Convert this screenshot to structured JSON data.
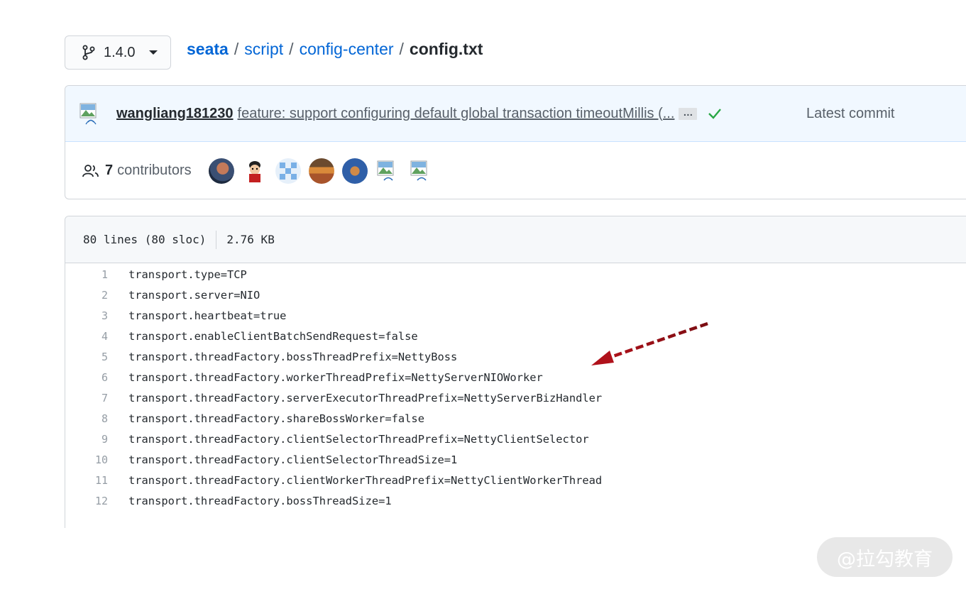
{
  "branch": {
    "label": "1.4.0"
  },
  "breadcrumb": {
    "root": "seata",
    "parts": [
      "script",
      "config-center"
    ],
    "separator": "/",
    "file": "config.txt"
  },
  "commit": {
    "author": "wangliang181230",
    "message": "feature: support configuring default global transaction timeoutMillis (...",
    "ellipsis": "…",
    "latest_label": "Latest commit",
    "status_color": "#28a745"
  },
  "contributors": {
    "count": "7",
    "label": "contributors",
    "avatars": [
      "avatar-1",
      "avatar-2",
      "avatar-3",
      "avatar-4",
      "avatar-5",
      "avatar-6-broken",
      "avatar-7-broken"
    ]
  },
  "file": {
    "lines_info": "80 lines (80 sloc)",
    "size": "2.76 KB",
    "lines": [
      {
        "n": "1",
        "text": "transport.type=TCP"
      },
      {
        "n": "2",
        "text": "transport.server=NIO"
      },
      {
        "n": "3",
        "text": "transport.heartbeat=true"
      },
      {
        "n": "4",
        "text": "transport.enableClientBatchSendRequest=false"
      },
      {
        "n": "5",
        "text": "transport.threadFactory.bossThreadPrefix=NettyBoss"
      },
      {
        "n": "6",
        "text": "transport.threadFactory.workerThreadPrefix=NettyServerNIOWorker"
      },
      {
        "n": "7",
        "text": "transport.threadFactory.serverExecutorThreadPrefix=NettyServerBizHandler"
      },
      {
        "n": "8",
        "text": "transport.threadFactory.shareBossWorker=false"
      },
      {
        "n": "9",
        "text": "transport.threadFactory.clientSelectorThreadPrefix=NettyClientSelector"
      },
      {
        "n": "10",
        "text": "transport.threadFactory.clientSelectorThreadSize=1"
      },
      {
        "n": "11",
        "text": "transport.threadFactory.clientWorkerThreadPrefix=NettyClientWorkerThread"
      },
      {
        "n": "12",
        "text": "transport.threadFactory.bossThreadSize=1"
      }
    ]
  },
  "annotation": {
    "arrow_color": "#b0121b"
  },
  "watermark": {
    "text": "@拉勾教育"
  }
}
